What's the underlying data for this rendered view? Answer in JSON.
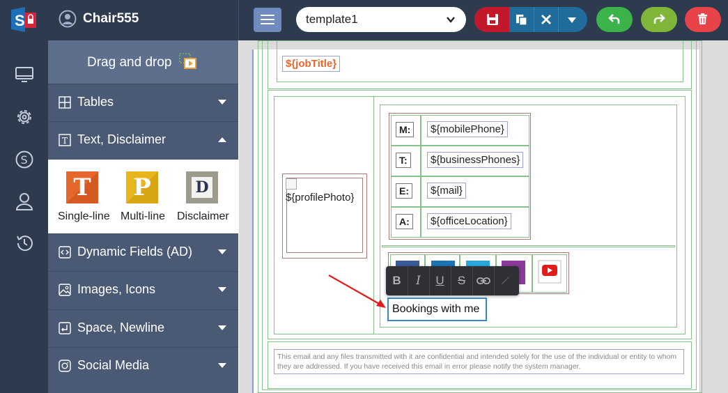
{
  "app": {
    "username": "Chair555",
    "template_value": "template1"
  },
  "icons": {
    "logo": "signature-logo-icon",
    "user": "user-circle-icon",
    "menu": "hamburger-icon",
    "save": "save-icon",
    "copy": "copy-icon",
    "close": "close-icon",
    "more": "chevron-down-icon",
    "undo": "undo-icon",
    "redo": "redo-icon",
    "delete": "trash-icon"
  },
  "rail": [
    "monitor-icon",
    "gear-icon",
    "dollar-icon",
    "user-icon",
    "history-icon"
  ],
  "sidebar": {
    "dnd_label": "Drag and drop",
    "sections": [
      {
        "label": "Tables",
        "icon": "table-icon",
        "expanded": false
      },
      {
        "label": "Text, Disclaimer",
        "icon": "text-icon",
        "expanded": true
      },
      {
        "label": "Dynamic Fields (AD)",
        "icon": "code-icon",
        "expanded": false
      },
      {
        "label": "Images, Icons",
        "icon": "image-icon",
        "expanded": false
      },
      {
        "label": "Space, Newline",
        "icon": "newline-icon",
        "expanded": false
      },
      {
        "label": "Social Media",
        "icon": "instagram-icon",
        "expanded": false
      }
    ],
    "palette": [
      {
        "letter": "T",
        "label": "Single-line",
        "color": "#e5672c"
      },
      {
        "letter": "P",
        "label": "Multi-line",
        "color": "#e8b51c"
      },
      {
        "letter": "D",
        "label": "Disclaimer",
        "color": "#9c9b8e"
      }
    ]
  },
  "canvas": {
    "job_title": "${jobTitle}",
    "profile_photo": "${profilePhoto}",
    "contact_rows": [
      {
        "label": "M:",
        "value": "${mobilePhone}"
      },
      {
        "label": "T:",
        "value": "${businessPhones}"
      },
      {
        "label": "E:",
        "value": "${mail}"
      },
      {
        "label": "A:",
        "value": "${officeLocation}"
      }
    ],
    "editing_text": "Bookings with me",
    "disclaimer": "This email and any files transmitted with it are confidential and intended solely for the use of the individual or entity to whom they are addressed. If you have received this email in error please notify the system manager."
  },
  "format_toolbar": [
    "B",
    "I",
    "U",
    "S"
  ],
  "colors": {
    "topbar": "#2e3a4d",
    "sidebar": "#4a5a74",
    "save": "#c4172a",
    "undo": "#3cb34a",
    "redo": "#7fb63a",
    "delete": "#e8424a",
    "job_title": "#e5672c"
  }
}
